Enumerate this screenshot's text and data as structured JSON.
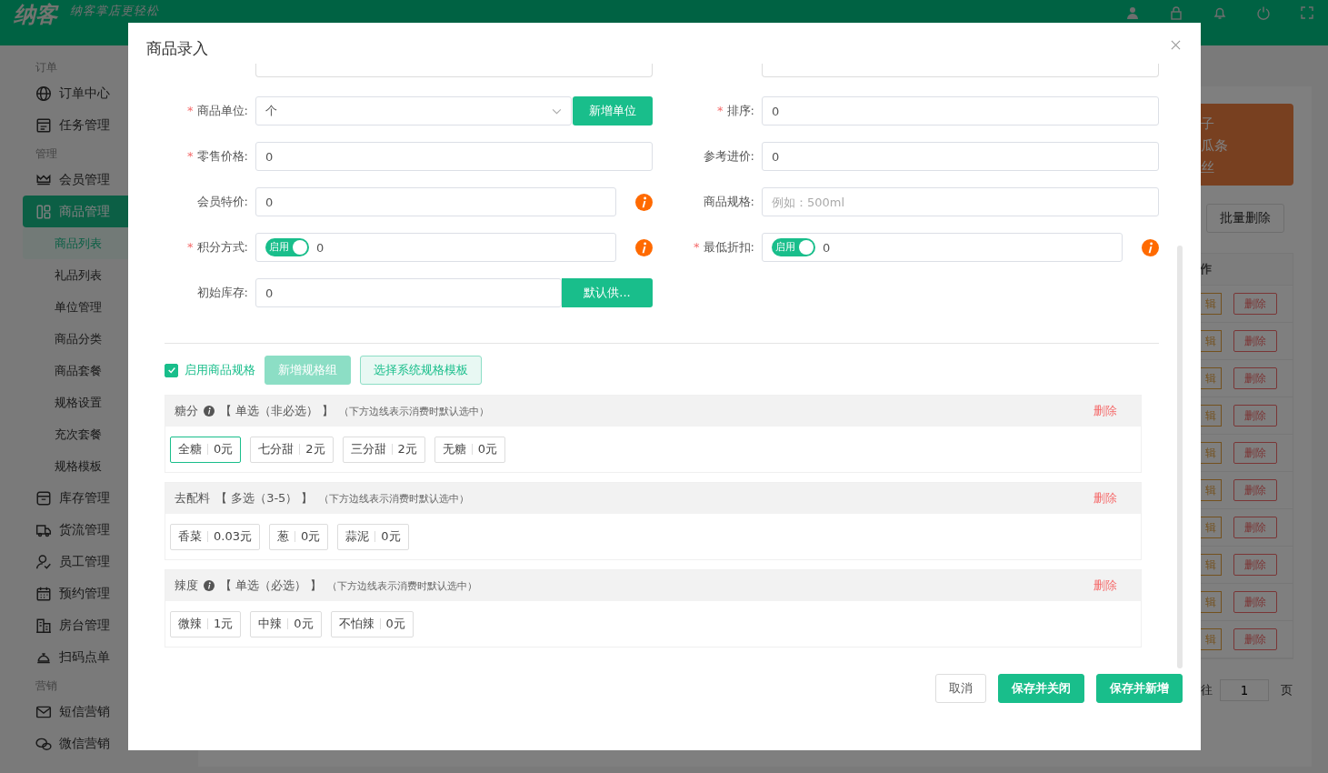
{
  "topbar": {
    "logo": "纳客",
    "slogan": "纳客掌店更轻松"
  },
  "sidebar": [
    {
      "title": "订单",
      "items": [
        {
          "label": "订单中心",
          "kind": "globe",
          "selected": false
        },
        {
          "label": "任务管理",
          "kind": "task",
          "selected": false
        }
      ]
    },
    {
      "title": "管理",
      "items": [
        {
          "label": "会员管理",
          "kind": "crown",
          "selected": false
        },
        {
          "label": "商品管理",
          "kind": "grid",
          "selected": true,
          "children": [
            {
              "label": "商品列表",
              "selected": true
            },
            {
              "label": "礼品列表",
              "selected": false
            },
            {
              "label": "单位管理",
              "selected": false
            },
            {
              "label": "商品分类",
              "selected": false
            },
            {
              "label": "商品套餐",
              "selected": false
            },
            {
              "label": "规格设置",
              "selected": false
            },
            {
              "label": "充次套餐",
              "selected": false
            },
            {
              "label": "规格模板",
              "selected": false
            }
          ]
        },
        {
          "label": "库存管理",
          "kind": "box",
          "selected": false
        },
        {
          "label": "货流管理",
          "kind": "truck",
          "selected": false
        },
        {
          "label": "员工管理",
          "kind": "user",
          "selected": false
        },
        {
          "label": "预约管理",
          "kind": "calendar",
          "selected": false
        },
        {
          "label": "房台管理",
          "kind": "building",
          "selected": false
        },
        {
          "label": "扫码点单",
          "kind": "dish",
          "selected": false
        }
      ]
    },
    {
      "title": "营销",
      "items": [
        {
          "label": "短信营销",
          "kind": "mail",
          "selected": false
        },
        {
          "label": "微信营销",
          "kind": "chat",
          "selected": false
        }
      ]
    }
  ],
  "background": {
    "promo_lines": [
      "子",
      "瓜条",
      "丝"
    ],
    "batch_delete": "批量删除",
    "table_header": "作",
    "rows": [
      {
        "edit": "辑",
        "delete": "删除"
      },
      {
        "edit": "辑",
        "delete": "删除"
      },
      {
        "edit": "辑",
        "delete": "删除"
      },
      {
        "edit": "辑",
        "delete": "删除"
      },
      {
        "edit": "辑",
        "delete": "删除"
      },
      {
        "edit": "辑",
        "delete": "删除"
      },
      {
        "edit": "辑",
        "delete": "删除"
      },
      {
        "edit": "辑",
        "delete": "删除"
      },
      {
        "edit": "辑",
        "delete": "删除"
      },
      {
        "edit": "辑",
        "delete": "删除"
      }
    ],
    "pagination": {
      "goto": "往",
      "page": "1",
      "suffix": "页"
    }
  },
  "modal": {
    "title": "商品录入",
    "fields_left": [
      {
        "kind": "select",
        "label": "商品单位:",
        "required_mark": "*",
        "value": "个",
        "action": "新增单位"
      },
      {
        "kind": "text",
        "label": "零售价格:",
        "required_mark": "*",
        "value": "0"
      },
      {
        "kind": "text",
        "label": "会员特价:",
        "value": "0",
        "info": true
      },
      {
        "kind": "toggle",
        "label": "积分方式:",
        "required_mark": "*",
        "value": "0",
        "toggle": {
          "label": "启用",
          "on": true
        },
        "info": true
      },
      {
        "kind": "text",
        "label": "初始库存:",
        "info": false,
        "value": "0",
        "action": "默认供..."
      }
    ],
    "fields_right": [
      {
        "kind": "text",
        "label": "排序:",
        "required_mark": "*",
        "value": "0"
      },
      {
        "kind": "text",
        "label": "参考进价:",
        "value": "0"
      },
      {
        "kind": "text",
        "label": "商品规格:",
        "placeholder": "例如：500ml"
      },
      {
        "kind": "toggle",
        "label": "最低折扣:",
        "required_mark": "*",
        "value": "0",
        "toggle": {
          "label": "启用",
          "on": true
        },
        "info": true
      }
    ],
    "spec": {
      "enable": {
        "label": "启用商品规格",
        "checked": true
      },
      "add_group": {
        "label": "新增规格组",
        "disabled": true
      },
      "template": "选择系统规格模板",
      "groups": [
        {
          "name": "糖分",
          "info": true,
          "mode": "【 单选（非必选） 】",
          "note": "（下方边线表示消费时默认选中）",
          "delete": "删除",
          "options": [
            {
              "name": "全糖",
              "price": "0元",
              "selected": true
            },
            {
              "name": "七分甜",
              "price": "2元",
              "selected": false
            },
            {
              "name": "三分甜",
              "price": "2元",
              "selected": false
            },
            {
              "name": "无糖",
              "price": "0元",
              "selected": false
            }
          ]
        },
        {
          "name": "去配料",
          "info": false,
          "mode": "【 多选（3-5） 】",
          "note": "（下方边线表示消费时默认选中）",
          "delete": "删除",
          "options": [
            {
              "name": "香菜",
              "price": "0.03元",
              "selected": false
            },
            {
              "name": "葱",
              "price": "0元",
              "selected": false
            },
            {
              "name": "蒜泥",
              "price": "0元",
              "selected": false
            }
          ]
        },
        {
          "name": "辣度",
          "info": true,
          "mode": "【 单选（必选） 】",
          "note": "（下方边线表示消费时默认选中）",
          "delete": "删除",
          "options": [
            {
              "name": "微辣",
              "price": "1元",
              "selected": false
            },
            {
              "name": "中辣",
              "price": "0元",
              "selected": false
            },
            {
              "name": "不怕辣",
              "price": "0元",
              "selected": false
            }
          ]
        }
      ]
    },
    "buttons": [
      {
        "label": "取消",
        "kind": "plain"
      },
      {
        "label": "保存并关闭",
        "kind": "primary"
      },
      {
        "label": "保存并新增",
        "kind": "primary"
      }
    ]
  }
}
